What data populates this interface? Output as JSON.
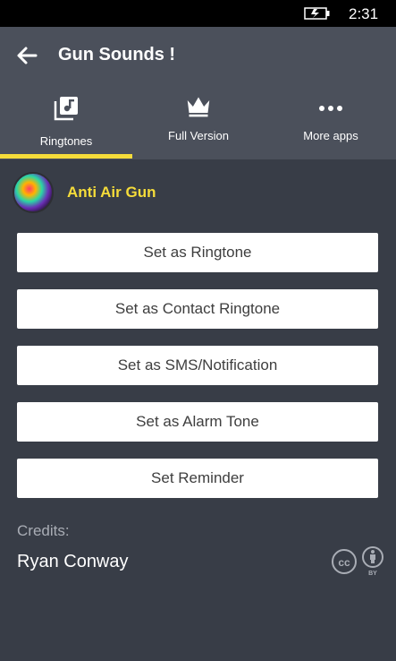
{
  "status_bar": {
    "time": "2:31",
    "battery_icon": "battery-charging-icon"
  },
  "header": {
    "title": "Gun Sounds !",
    "back_icon": "back-arrow-icon"
  },
  "tabs": [
    {
      "label": "Ringtones",
      "icon": "music-library-icon",
      "selected": true
    },
    {
      "label": "Full Version",
      "icon": "crown-icon",
      "selected": false
    },
    {
      "label": "More apps",
      "icon": "more-dots-icon",
      "selected": false
    }
  ],
  "ringtone": {
    "name": "Anti Air Gun",
    "avatar": "ringtone-thumbnail"
  },
  "actions": [
    {
      "label": "Set as Ringtone"
    },
    {
      "label": "Set as Contact Ringtone"
    },
    {
      "label": "Set as SMS/Notification"
    },
    {
      "label": "Set as Alarm Tone"
    },
    {
      "label": "Set Reminder"
    }
  ],
  "credits": {
    "label": "Credits:",
    "author": "Ryan Conway",
    "license_icons": [
      "cc-icon",
      "by-icon"
    ],
    "by_text": "BY"
  },
  "colors": {
    "accent": "#f5dc3a",
    "header_bg": "#4b505b",
    "page_bg": "#383d47",
    "button_bg": "#ffffff",
    "button_text": "#3e3e3e"
  }
}
